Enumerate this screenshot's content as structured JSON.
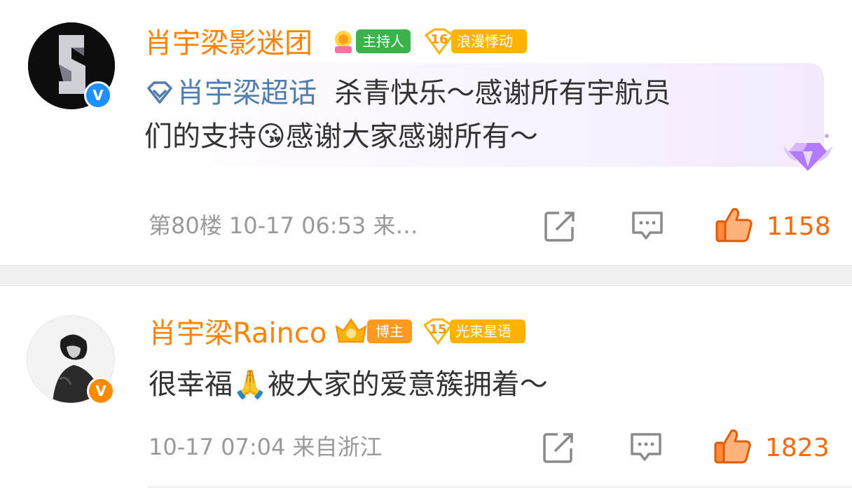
{
  "comments": [
    {
      "username": "肖宇梁影迷团",
      "host_tag": "主持人",
      "fan_level": "16",
      "fan_title": "浪漫悸动",
      "topic": "肖宇梁超话",
      "text_line1": "杀青快乐～感谢所有宇航员",
      "text_line2_a": "们的支持",
      "emoji": "😘",
      "text_line2_b": "感谢大家感谢所有～",
      "floor": "第80楼",
      "time": "10-17 06:53",
      "source": "来…",
      "likes": "1158",
      "avatar_mark": "S",
      "verify_mark": "V"
    },
    {
      "username": "肖宇梁Rainco",
      "blogger_tag": "博主",
      "fan_level": "15",
      "fan_title": "光束星语",
      "text_a": "很幸福",
      "emoji": "🙏",
      "text_b": "被大家的爱意簇拥着～",
      "time": "10-17 07:04",
      "source": "来自浙江",
      "likes": "1823",
      "verify_mark": "V"
    }
  ],
  "colors": {
    "name": "#ff8200",
    "topic": "#507daf",
    "like": "#ff6a00",
    "meta": "#999999",
    "host_tag": "#3bb34a",
    "fan_tag": "#ffb300"
  }
}
